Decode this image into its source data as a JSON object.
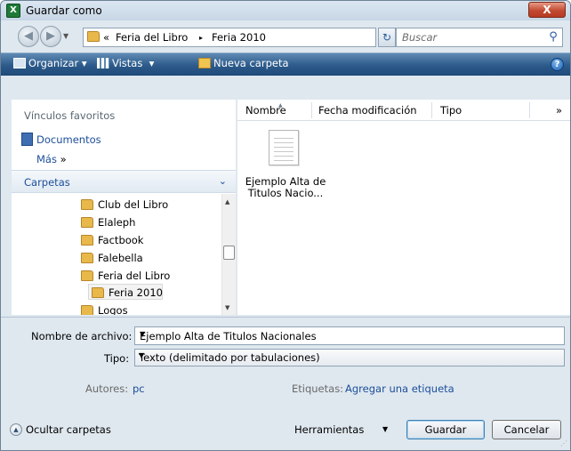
{
  "window": {
    "title": "Guardar como",
    "close_label": "X"
  },
  "address": {
    "prefix": "«",
    "crumbs": [
      "Feria del Libro",
      "Feria 2010"
    ],
    "separator": "▸"
  },
  "search": {
    "placeholder": "Buscar"
  },
  "toolbar": {
    "organize": "Organizar",
    "views": "Vistas",
    "new_folder": "Nueva carpeta",
    "help": "?"
  },
  "favorites": {
    "title": "Vínculos favoritos",
    "items": [
      "Documentos"
    ],
    "more": "Más",
    "more_suffix": "»"
  },
  "folders": {
    "title": "Carpetas",
    "items": [
      "Club del Libro",
      "Elaleph",
      "Factbook",
      "Falebella",
      "Feria del Libro",
      "Feria 2010",
      "Logos"
    ],
    "selected": "Feria 2010"
  },
  "columns": {
    "name": "Nombre",
    "modified": "Fecha modificación",
    "type": "Tipo",
    "more": "»"
  },
  "files": [
    {
      "name_line1": "Ejemplo Alta de",
      "name_line2": "Titulos Nacio..."
    }
  ],
  "form": {
    "filename_label": "Nombre de archivo:",
    "filename_value": "Ejemplo Alta de Titulos Nacionales",
    "type_label": "Tipo:",
    "type_value": "Texto (delimitado por tabulaciones)",
    "authors_label": "Autores:",
    "authors_value": "pc",
    "tags_label": "Etiquetas:",
    "tags_value": "Agregar una etiqueta"
  },
  "footer": {
    "hide_folders": "Ocultar carpetas",
    "tools": "Herramientas",
    "save": "Guardar",
    "cancel": "Cancelar"
  },
  "colors": {
    "toolbar": "#2c5a8a",
    "link": "#1c4e9a",
    "folder": "#e8b84a"
  }
}
